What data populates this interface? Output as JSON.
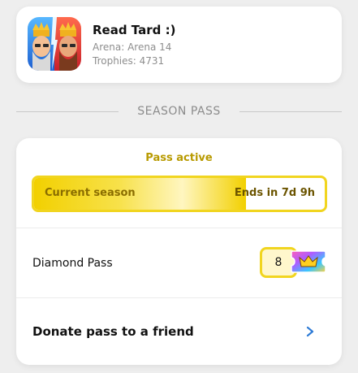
{
  "profile": {
    "name": "Read Tard :)",
    "arena": "Arena: Arena 14",
    "trophies": "Trophies: 4731",
    "app_icon": "clash-royale-app-icon"
  },
  "section": {
    "title": "SEASON PASS"
  },
  "pass": {
    "status": "Pass active",
    "current_season_label": "Current season",
    "ends_label": "Ends in 7d 9h",
    "season_progress_fraction": 0.73
  },
  "diamond_pass": {
    "label": "Diamond Pass",
    "count": "8",
    "icon": "diamond-pass-ticket-icon"
  },
  "donate": {
    "label": "Donate pass to a friend",
    "icon": "chevron-right-icon"
  },
  "colors": {
    "accent_yellow": "#f1d51f",
    "status_gold": "#b89a00",
    "chevron_blue": "#2e7bd6",
    "background": "#eeeeee"
  }
}
